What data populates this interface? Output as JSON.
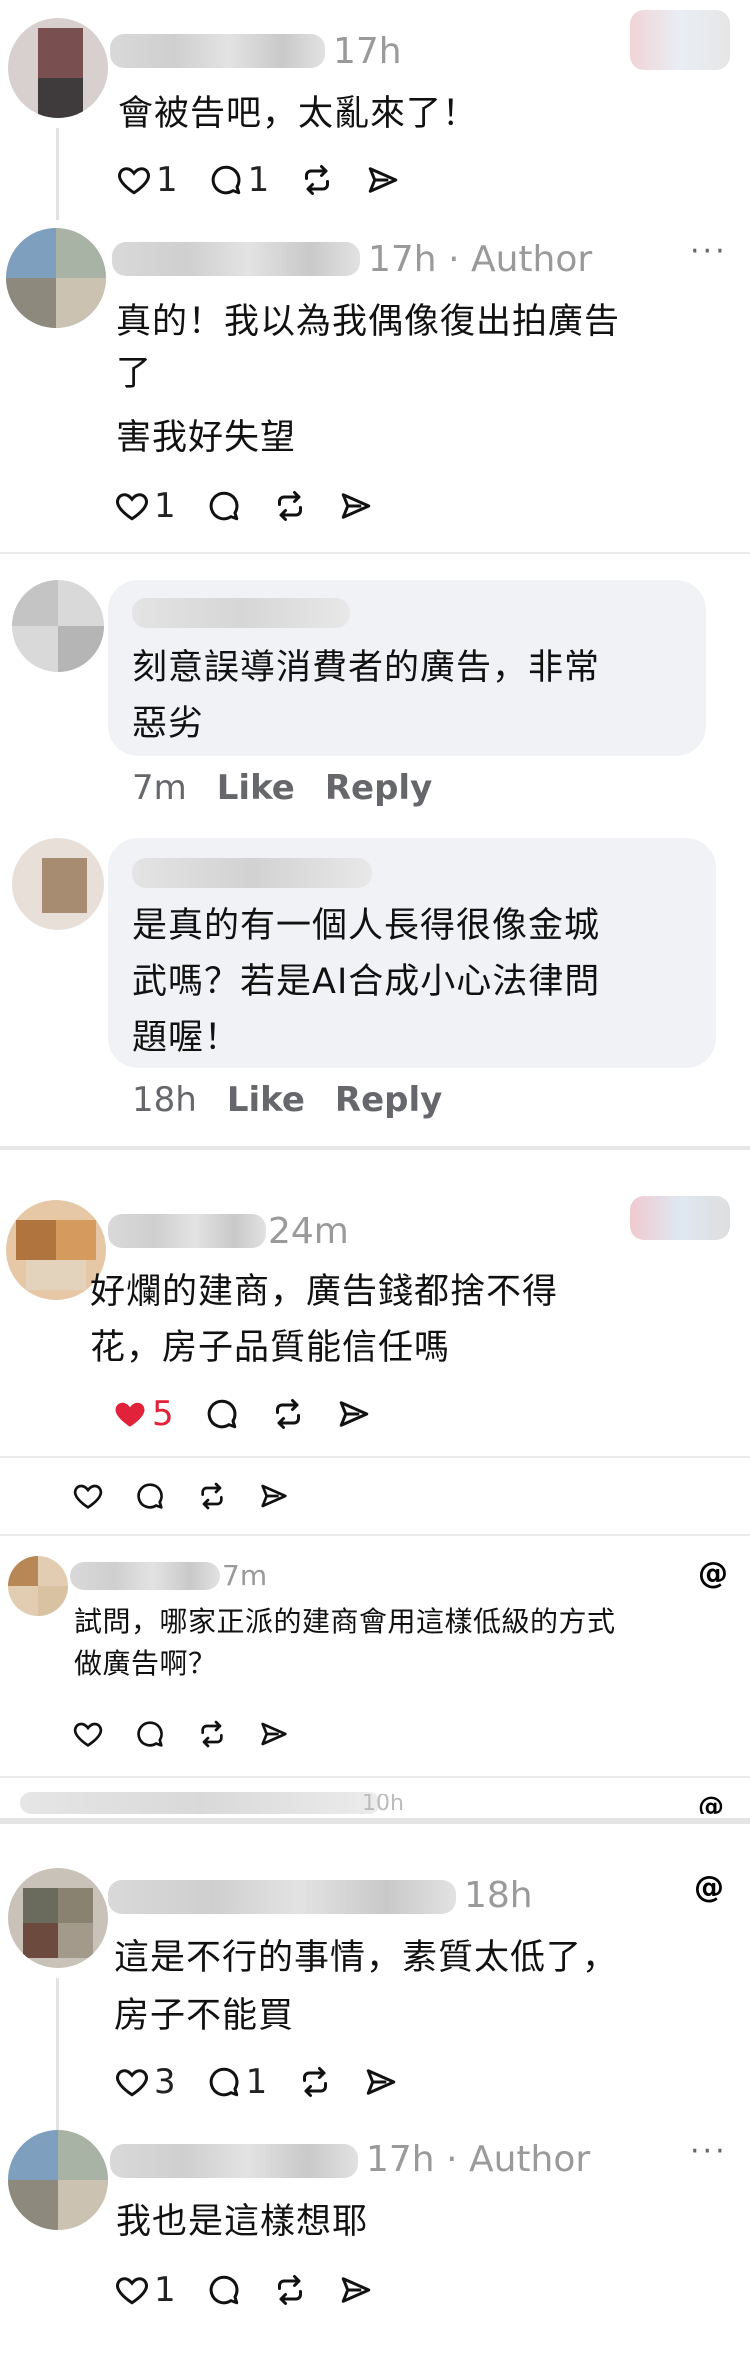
{
  "c1": {
    "time": "17h",
    "text": "會被告吧，太亂來了！",
    "likes": "1",
    "replies": "1"
  },
  "c2": {
    "time": "17h · Author",
    "text_lines": [
      "真的！我以為我偶像復出拍廣告",
      "了",
      "害我好失望"
    ],
    "likes": "1",
    "more": "···"
  },
  "fb1": {
    "text_lines": [
      "刻意誤導消費者的廣告，非常",
      "惡劣"
    ],
    "time": "7m",
    "like": "Like",
    "reply": "Reply"
  },
  "fb2": {
    "text_lines": [
      "是真的有一個人長得很像金城",
      "武嗎？若是AI合成小心法律問",
      "題喔！"
    ],
    "time": "18h",
    "like": "Like",
    "reply": "Reply"
  },
  "c3": {
    "time": "24m",
    "text_lines": [
      "好爛的建商，廣告錢都捨不得",
      "花，房子品質能信任嗎"
    ],
    "likes": "5",
    "like_color": "#e0233a"
  },
  "c5": {
    "time": "7m",
    "text_lines": [
      "試問，哪家正派的建商會用這樣低級的方式",
      "做廣告啊？"
    ],
    "app_icon": "threads-icon"
  },
  "c6": {
    "partial_time": "10h"
  },
  "c7": {
    "time": "18h",
    "text_lines": [
      "這是不行的事情，素質太低了，",
      "房子不能買"
    ],
    "likes": "3",
    "replies": "1"
  },
  "c8": {
    "time": "17h · Author",
    "text": "我也是這樣想耶",
    "likes": "1",
    "more": "···"
  }
}
